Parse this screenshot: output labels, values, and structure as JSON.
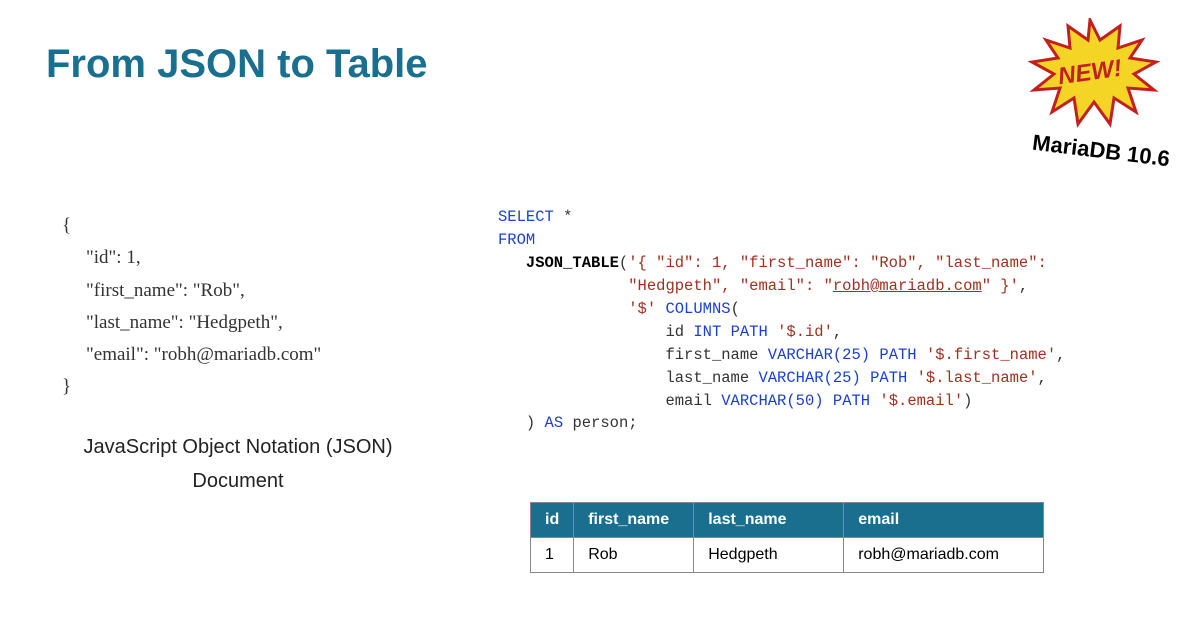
{
  "title": "From JSON to Table",
  "badge": {
    "text": "NEW!",
    "version": "MariaDB 10.6"
  },
  "json_doc": {
    "open": "{",
    "line_id": "\"id\": 1,",
    "line_fn": "\"first_name\": \"Rob\",",
    "line_ln": "\"last_name\": \"Hedgpeth\",",
    "line_em": "\"email\": \"robh@mariadb.com\"",
    "close": "}"
  },
  "json_caption_l1": "JavaScript Object Notation (JSON)",
  "json_caption_l2": "Document",
  "sql": {
    "select": "SELECT",
    "star": " *",
    "from": "FROM",
    "json_table": "JSON_TABLE",
    "open_paren": "(",
    "json_arg_a": "'{ \"id\": 1, \"first_name\": \"Rob\", \"last_name\":",
    "json_arg_b": "\"Hedgpeth\", \"email\": \"",
    "json_arg_email": "robh@mariadb.com",
    "json_arg_c": "\" }'",
    "comma": ",",
    "path_root": "'$'",
    "columns_kw": "COLUMNS",
    "col_open": "(",
    "col_id_a": "id ",
    "int_kw": "INT",
    "path_kw": "PATH",
    "p_id": "'$.id'",
    "col_fn_a": "first_name ",
    "varchar25": "VARCHAR(25)",
    "p_fn": "'$.first_name'",
    "col_ln_a": "last_name ",
    "p_ln": "'$.last_name'",
    "col_em_a": "email ",
    "varchar50": "VARCHAR(50)",
    "p_em": "'$.email'",
    "col_close": ")",
    "close_paren": ")",
    "as_kw": "AS",
    "alias": " person;"
  },
  "table": {
    "headers": {
      "id": "id",
      "first_name": "first_name",
      "last_name": "last_name",
      "email": "email"
    },
    "row": {
      "id": "1",
      "first_name": "Rob",
      "last_name": "Hedgpeth",
      "email": "robh@mariadb.com"
    }
  }
}
